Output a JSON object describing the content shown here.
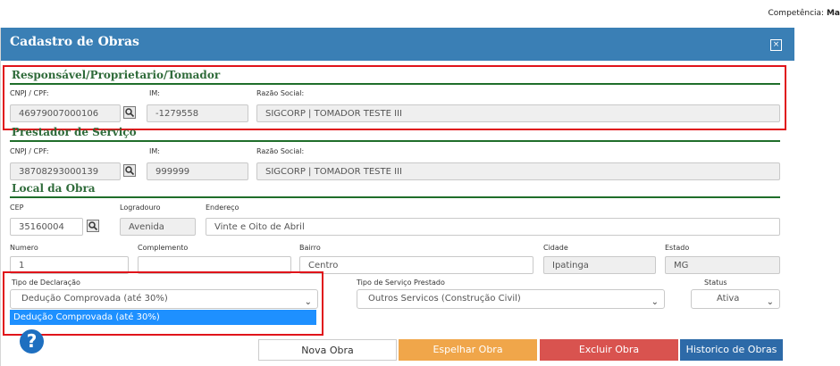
{
  "competencia": {
    "label": "Competência:",
    "value": "Ma"
  },
  "modal": {
    "title": "Cadastro de Obras",
    "close_glyph": "×"
  },
  "responsavel": {
    "section_title": "Responsável/Proprietario/Tomador",
    "cnpj_label": "CNPJ / CPF:",
    "cnpj_value": "46979007000106",
    "im_label": "IM:",
    "im_value": "-1279558",
    "razao_label": "Razão Social:",
    "razao_value": "SIGCORP | TOMADOR TESTE III"
  },
  "prestador": {
    "section_title": "Prestador de Serviço",
    "cnpj_label": "CNPJ / CPF:",
    "cnpj_value": "38708293000139",
    "im_label": "IM:",
    "im_value": "999999",
    "razao_label": "Razão Social:",
    "razao_value": "SIGCORP | TOMADOR TESTE III"
  },
  "local": {
    "section_title": "Local da Obra",
    "cep_label": "CEP",
    "cep_value": "35160004",
    "logradouro_label": "Logradouro",
    "logradouro_value": "Avenida",
    "endereco_label": "Endereço",
    "endereco_value": "Vinte e Oito de Abril",
    "numero_label": "Numero",
    "numero_value": "1",
    "complemento_label": "Complemento",
    "complemento_value": "",
    "bairro_label": "Bairro",
    "bairro_value": "Centro",
    "cidade_label": "Cidade",
    "cidade_value": "Ipatinga",
    "estado_label": "Estado",
    "estado_value": "MG"
  },
  "declaracao": {
    "tipo_label": "Tipo de Declaração",
    "tipo_value": "Dedução Comprovada (até 30%)",
    "dropdown_option": "Dedução Comprovada (até 30%)",
    "servico_label": "Tipo de Serviço Prestado",
    "servico_value": "Outros Servicos (Construção Civil)",
    "status_label": "Status",
    "status_value": "Ativa"
  },
  "buttons": {
    "nova": "Nova Obra",
    "espelhar": "Espelhar Obra",
    "excluir": "Excluir Obra",
    "historico": "Historico de Obras",
    "help": "?"
  },
  "colors": {
    "header": "#3a7fb5",
    "section": "#2f6b3a",
    "espelhar": "#f0a64a",
    "excluir": "#d9534f",
    "historico": "#2d6aa8",
    "highlight": "#e0141a",
    "dropdown": "#1e90ff"
  }
}
